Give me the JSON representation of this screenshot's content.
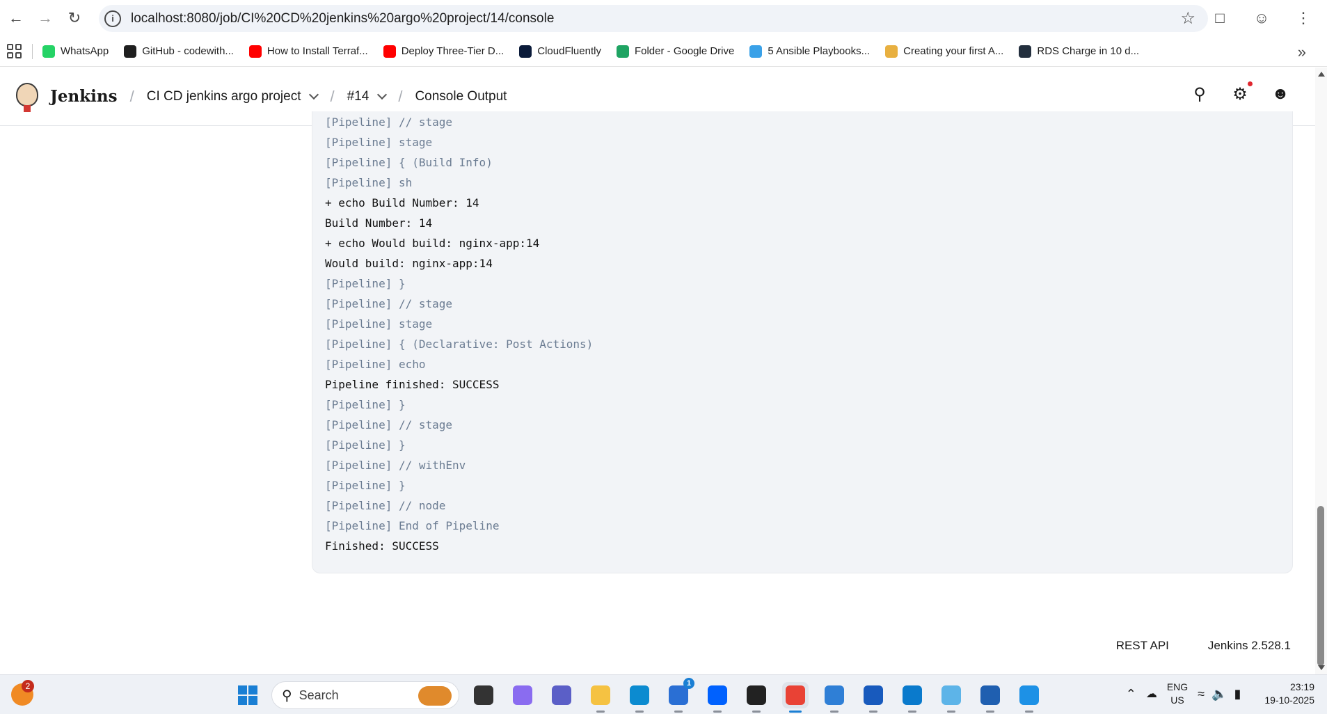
{
  "browser": {
    "url": "localhost:8080/job/CI%20CD%20jenkins%20argo%20project/14/console",
    "bookmarks": [
      {
        "label": "WhatsApp",
        "color": "#25d366"
      },
      {
        "label": "GitHub - codewith...",
        "color": "#1f1f1f"
      },
      {
        "label": "How to Install Terraf...",
        "color": "#ff0000"
      },
      {
        "label": "Deploy Three-Tier D...",
        "color": "#ff0000"
      },
      {
        "label": "CloudFluently",
        "color": "#0b1b3a"
      },
      {
        "label": "Folder - Google Drive",
        "color": "#1fa463"
      },
      {
        "label": "5 Ansible Playbooks...",
        "color": "#3aa1e8"
      },
      {
        "label": "Creating your first A...",
        "color": "#e8b040"
      },
      {
        "label": "RDS Charge in 10 d...",
        "color": "#232f3e"
      }
    ]
  },
  "jenkins": {
    "title": "Jenkins",
    "breadcrumbs": [
      "CI CD jenkins argo project",
      "#14",
      "Console Output"
    ]
  },
  "console": {
    "lines": [
      {
        "text": "[Pipeline] // stage",
        "kind": "meta"
      },
      {
        "text": "[Pipeline] stage",
        "kind": "meta"
      },
      {
        "text": "[Pipeline] { (Build Info)",
        "kind": "meta"
      },
      {
        "text": "[Pipeline] sh",
        "kind": "meta"
      },
      {
        "text": "+ echo Build Number: 14",
        "kind": "out"
      },
      {
        "text": "Build Number: 14",
        "kind": "out"
      },
      {
        "text": "+ echo Would build: nginx-app:14",
        "kind": "out"
      },
      {
        "text": "Would build: nginx-app:14",
        "kind": "out"
      },
      {
        "text": "[Pipeline] }",
        "kind": "meta"
      },
      {
        "text": "[Pipeline] // stage",
        "kind": "meta"
      },
      {
        "text": "[Pipeline] stage",
        "kind": "meta"
      },
      {
        "text": "[Pipeline] { (Declarative: Post Actions)",
        "kind": "meta"
      },
      {
        "text": "[Pipeline] echo",
        "kind": "meta"
      },
      {
        "text": "Pipeline finished: SUCCESS",
        "kind": "out"
      },
      {
        "text": "[Pipeline] }",
        "kind": "meta"
      },
      {
        "text": "[Pipeline] // stage",
        "kind": "meta"
      },
      {
        "text": "[Pipeline] }",
        "kind": "meta"
      },
      {
        "text": "[Pipeline] // withEnv",
        "kind": "meta"
      },
      {
        "text": "[Pipeline] }",
        "kind": "meta"
      },
      {
        "text": "[Pipeline] // node",
        "kind": "meta"
      },
      {
        "text": "[Pipeline] End of Pipeline",
        "kind": "meta"
      },
      {
        "text": "Finished: SUCCESS",
        "kind": "out"
      }
    ]
  },
  "footer": {
    "rest_api": "REST API",
    "version": "Jenkins 2.528.1"
  },
  "taskbar": {
    "weather_badge": "2",
    "search_placeholder": "Search",
    "apps": [
      {
        "name": "file-explorer-dark",
        "color": "#333333"
      },
      {
        "name": "copilot",
        "color": "#8a6cf0"
      },
      {
        "name": "teams",
        "color": "#5b5fc7"
      },
      {
        "name": "file-explorer",
        "color": "#f5c242"
      },
      {
        "name": "edge",
        "color": "#0c8bd0"
      },
      {
        "name": "store",
        "color": "#2a6fd4",
        "badge": "1"
      },
      {
        "name": "dropbox",
        "color": "#0061fe"
      },
      {
        "name": "amazon",
        "color": "#222222"
      },
      {
        "name": "chrome",
        "color": "#e94235",
        "active": true
      },
      {
        "name": "notepad",
        "color": "#2f7fd6"
      },
      {
        "name": "word",
        "color": "#185abd"
      },
      {
        "name": "vscode",
        "color": "#0a7acc"
      },
      {
        "name": "git",
        "color": "#5db4e8"
      },
      {
        "name": "powershell",
        "color": "#1f5fb0"
      },
      {
        "name": "docker",
        "color": "#1d91e6"
      }
    ],
    "lang_top": "ENG",
    "lang_bottom": "US",
    "time": "23:19",
    "date": "19-10-2025"
  }
}
